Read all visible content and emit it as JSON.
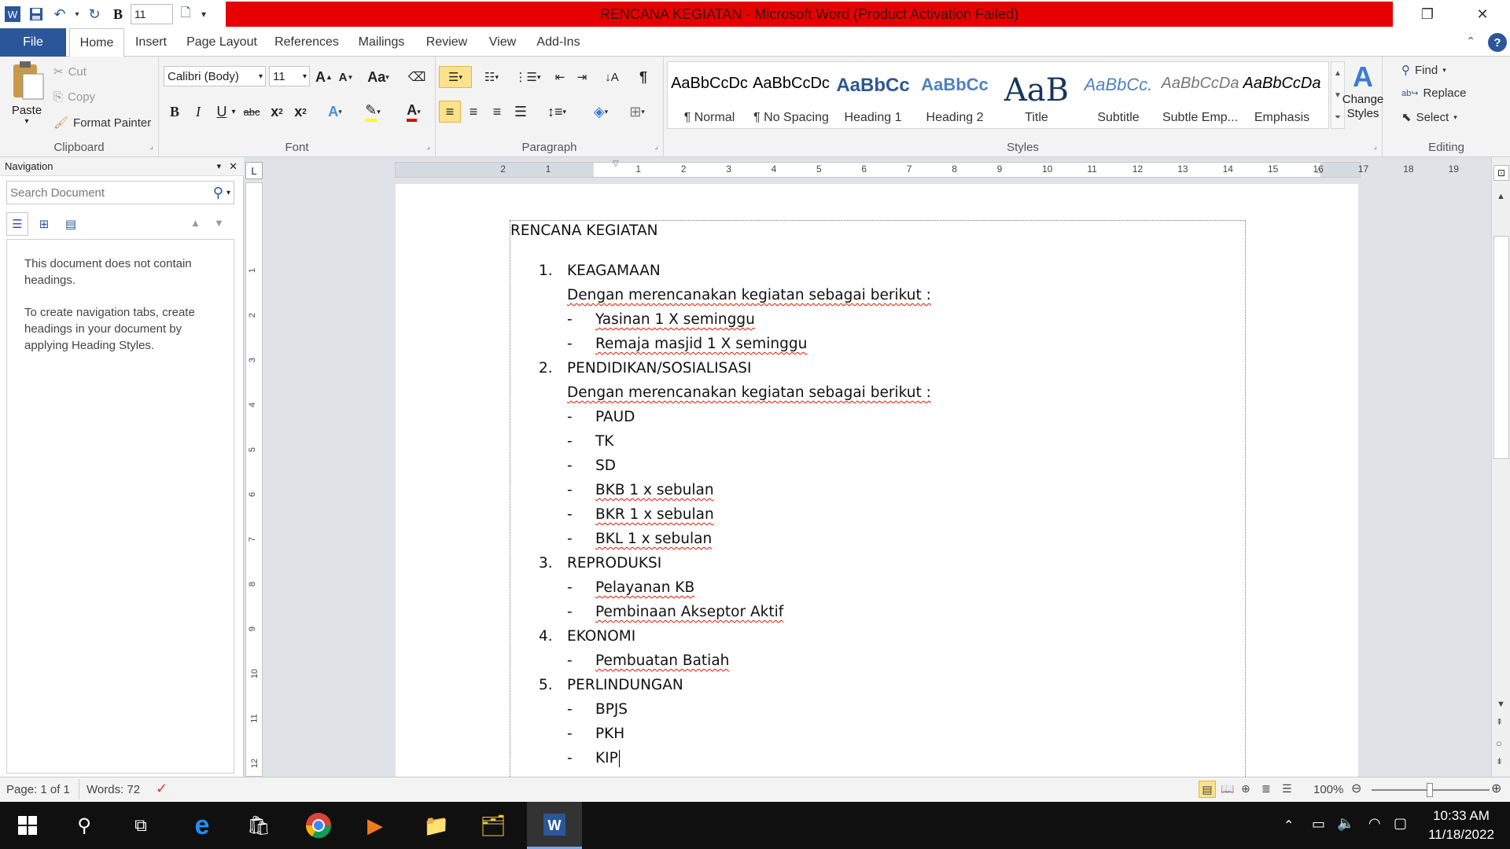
{
  "titlebar": {
    "title": "RENCANA KEGIATAN  -  Microsoft Word (Product Activation Failed)",
    "qat_font_size": "11"
  },
  "tabs": {
    "file": "File",
    "items": [
      "Home",
      "Insert",
      "Page Layout",
      "References",
      "Mailings",
      "Review",
      "View",
      "Add-Ins"
    ],
    "active": "Home"
  },
  "ribbon": {
    "clipboard": {
      "paste": "Paste",
      "cut": "Cut",
      "copy": "Copy",
      "format_painter": "Format Painter",
      "label": "Clipboard"
    },
    "font": {
      "name": "Calibri (Body)",
      "size": "11",
      "label": "Font"
    },
    "paragraph": {
      "label": "Paragraph"
    },
    "styles": {
      "label": "Styles",
      "items": [
        {
          "preview": "AaBbCcDc",
          "name": "¶ Normal"
        },
        {
          "preview": "AaBbCcDc",
          "name": "¶ No Spacing"
        },
        {
          "preview": "AaBbCc",
          "name": "Heading 1"
        },
        {
          "preview": "AaBbCc",
          "name": "Heading 2"
        },
        {
          "preview": "AaB",
          "name": "Title"
        },
        {
          "preview": "AaBbCc.",
          "name": "Subtitle"
        },
        {
          "preview": "AaBbCcDa",
          "name": "Subtle Emp..."
        },
        {
          "preview": "AaBbCcDa",
          "name": "Emphasis"
        }
      ],
      "change_styles": "Change Styles"
    },
    "editing": {
      "find": "Find",
      "replace": "Replace",
      "select": "Select",
      "label": "Editing"
    }
  },
  "nav": {
    "title": "Navigation",
    "search_placeholder": "Search Document",
    "msg1": "This document does not contain headings.",
    "msg2": "To create navigation tabs, create headings in your document by applying Heading Styles."
  },
  "ruler": {
    "labels": [
      "2",
      "1",
      "1",
      "2",
      "3",
      "4",
      "5",
      "6",
      "7",
      "8",
      "9",
      "10",
      "11",
      "12",
      "13",
      "14",
      "15",
      "16",
      "17",
      "18",
      "19"
    ],
    "v_labels": [
      "1",
      "2",
      "3",
      "4",
      "5",
      "6",
      "7",
      "8",
      "9",
      "10",
      "11",
      "12"
    ]
  },
  "document": {
    "heading": "RENCANA KEGIATAN",
    "lines": [
      {
        "kind": "num",
        "marker": "1.",
        "text": "KEAGAMAAN"
      },
      {
        "kind": "para",
        "text": "Dengan merencanakan kegiatan sebagai berikut :",
        "squiggle": true
      },
      {
        "kind": "dash",
        "text": "Yasinan 1 X seminggu",
        "squiggle": true
      },
      {
        "kind": "dash",
        "text": "Remaja masjid 1 X seminggu",
        "squiggle": true
      },
      {
        "kind": "num",
        "marker": "2.",
        "text": "PENDIDIKAN/SOSIALISASI"
      },
      {
        "kind": "para",
        "text": "Dengan merencanakan kegiatan sebagai berikut :",
        "squiggle": true
      },
      {
        "kind": "dash",
        "text": "PAUD"
      },
      {
        "kind": "dash",
        "text": "TK"
      },
      {
        "kind": "dash",
        "text": "SD"
      },
      {
        "kind": "dash",
        "text": "BKB 1 x sebulan",
        "squiggle": true
      },
      {
        "kind": "dash",
        "text": "BKR 1 x sebulan",
        "squiggle": true
      },
      {
        "kind": "dash",
        "text": "BKL 1 x sebulan",
        "squiggle": true
      },
      {
        "kind": "num",
        "marker": "3.",
        "text": "REPRODUKSI"
      },
      {
        "kind": "dash",
        "text": "Pelayanan KB",
        "squiggle": true
      },
      {
        "kind": "dash",
        "text": "Pembinaan Akseptor Aktif",
        "squiggle": true
      },
      {
        "kind": "num",
        "marker": "4.",
        "text": "EKONOMI"
      },
      {
        "kind": "dash",
        "text": "Pembuatan Batiah",
        "squiggle": true
      },
      {
        "kind": "num",
        "marker": "5.",
        "text": "PERLINDUNGAN"
      },
      {
        "kind": "dash",
        "text": "BPJS"
      },
      {
        "kind": "dash",
        "text": "PKH"
      },
      {
        "kind": "dash",
        "text": "KIP"
      }
    ]
  },
  "status": {
    "page": "Page: 1 of 1",
    "words": "Words: 72",
    "zoom": "100%"
  },
  "taskbar": {
    "time": "10:33 AM",
    "date": "11/18/2022"
  },
  "colors": {
    "title_bar_red": "#e60000",
    "word_blue": "#2b579a"
  }
}
